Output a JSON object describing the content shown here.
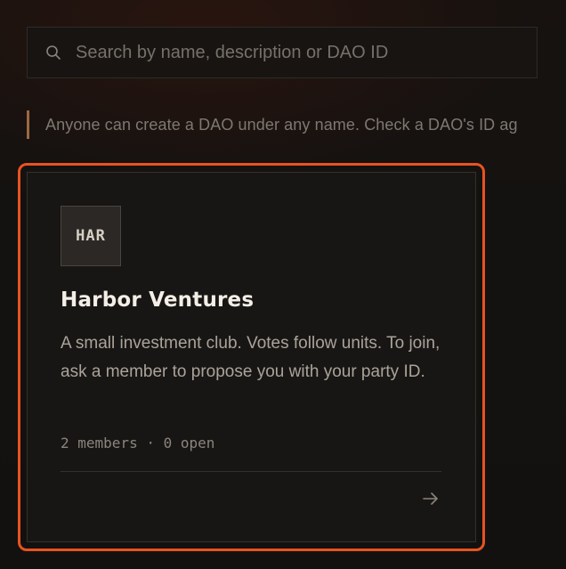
{
  "search": {
    "placeholder": "Search by name, description or DAO ID",
    "value": "",
    "icon": "search-icon"
  },
  "notice": {
    "text": "Anyone can create a DAO under any name. Check a DAO's ID ag",
    "accent_color": "#9b6a3f"
  },
  "dao_card": {
    "avatar_text": "HAR",
    "name": "Harbor Ventures",
    "description": "A small investment club. Votes follow units. To join, ask a member to propose you with your party ID.",
    "meta": "2 members · 0 open",
    "arrow_icon": "arrow-right-icon",
    "focus_color": "#e8531f"
  }
}
